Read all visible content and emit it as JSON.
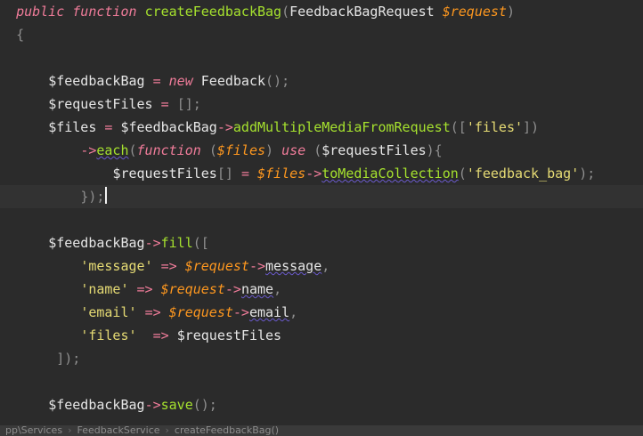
{
  "code": {
    "line1": {
      "kw1": "public",
      "kw2": "function",
      "fn": "createFeedbackBag",
      "open": "(",
      "type": "FeedbackBagRequest",
      "var": "$request",
      "close": ")"
    },
    "line2": {
      "brace": "{"
    },
    "line4": {
      "var": "$feedbackBag",
      "eq": "=",
      "kw": "new",
      "cls": "Feedback",
      "rest": "();"
    },
    "line5": {
      "var": "$requestFiles",
      "eq": "=",
      "rest": "[];"
    },
    "line6": {
      "var": "$files",
      "eq": "=",
      "obj": "$feedbackBag",
      "arrow": "->",
      "method": "addMultipleMediaFromRequest",
      "open": "([",
      "str": "'files'",
      "close": "])"
    },
    "line7": {
      "arrow": "->",
      "method": "each",
      "open": "(",
      "kw": "function",
      "p1": "(",
      "param": "$files",
      "p2": ")",
      "use": "use",
      "p3": "(",
      "usevar": "$requestFiles",
      "p4": "){"
    },
    "line8": {
      "var": "$requestFiles",
      "br": "[]",
      "eq": "=",
      "obj": "$files",
      "arrow": "->",
      "method": "toMediaCollection",
      "open": "(",
      "str": "'feedback_bag'",
      "close": ");"
    },
    "line9": {
      "close": "});"
    },
    "line11": {
      "var": "$feedbackBag",
      "arrow": "->",
      "method": "fill",
      "open": "(["
    },
    "line12": {
      "key": "'message'",
      "op": "=>",
      "obj": "$request",
      "arrow": "->",
      "prop": "message",
      "comma": ","
    },
    "line13": {
      "key": "'name'",
      "op": "=>",
      "obj": "$request",
      "arrow": "->",
      "prop": "name",
      "comma": ","
    },
    "line14": {
      "key": "'email'",
      "op": "=>",
      "obj": "$request",
      "arrow": "->",
      "prop": "email",
      "comma": ","
    },
    "line15": {
      "key": "'files'",
      "op": "=>",
      "val": "$requestFiles"
    },
    "line16": {
      "close": "]);"
    },
    "line18": {
      "var": "$feedbackBag",
      "arrow": "->",
      "method": "save",
      "close": "();"
    }
  },
  "breadcrumb": {
    "items": [
      "pp\\Services",
      "FeedbackService",
      "createFeedbackBag()"
    ],
    "sep": "›"
  },
  "colors": {
    "background": "#2b2b2b",
    "keyword": "#f07c9a",
    "function": "#a6e22e",
    "string": "#e6db74",
    "variable": "#fd971f"
  }
}
